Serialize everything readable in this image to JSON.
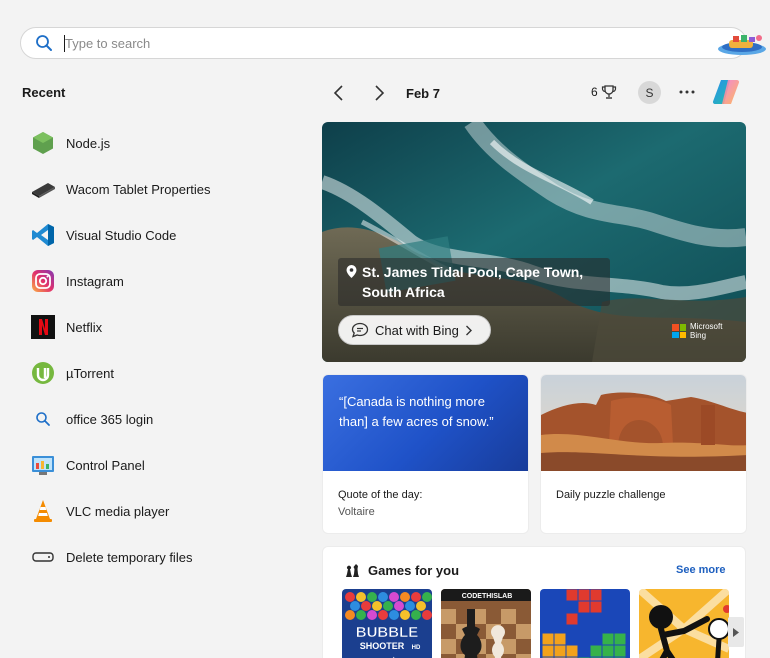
{
  "search": {
    "placeholder": "Type to search"
  },
  "recent": {
    "title": "Recent",
    "items": [
      {
        "label": "Node.js",
        "icon": "nodejs-icon"
      },
      {
        "label": "Wacom Tablet Properties",
        "icon": "wacom-tablet-icon"
      },
      {
        "label": "Visual Studio Code",
        "icon": "vscode-icon"
      },
      {
        "label": "Instagram",
        "icon": "instagram-icon"
      },
      {
        "label": "Netflix",
        "icon": "netflix-icon"
      },
      {
        "label": "µTorrent",
        "icon": "utorrent-icon"
      },
      {
        "label": "office 365 login",
        "icon": "search-icon"
      },
      {
        "label": "Control Panel",
        "icon": "control-panel-icon"
      },
      {
        "label": "VLC media player",
        "icon": "vlc-icon"
      },
      {
        "label": "Delete temporary files",
        "icon": "storage-icon"
      }
    ]
  },
  "header": {
    "date": "Feb 7",
    "points": "6",
    "avatar_initial": "S"
  },
  "hero": {
    "location": "St. James Tidal Pool, Cape Town, South Africa",
    "chat_label": "Chat with Bing",
    "brand_line1": "Microsoft",
    "brand_line2": "Bing"
  },
  "quote_card": {
    "quote": "“[Canada is nothing more than] a few acres of snow.”",
    "caption": "Quote of the day:",
    "author": "Voltaire"
  },
  "puzzle_card": {
    "caption": "Daily puzzle challenge"
  },
  "games": {
    "title": "Games for you",
    "see_more": "See more",
    "tiles": [
      {
        "name": "Bubble Shooter",
        "line1": "BUBBLE",
        "line2": "SHOOTER",
        "badge": "HD"
      },
      {
        "name": "Chess",
        "brand": "CODETHISLAB"
      },
      {
        "name": "Block puzzle"
      },
      {
        "name": "Stickman fight"
      }
    ]
  },
  "colors": {
    "accent": "#1d5fbf",
    "background": "#f3f3f3"
  }
}
